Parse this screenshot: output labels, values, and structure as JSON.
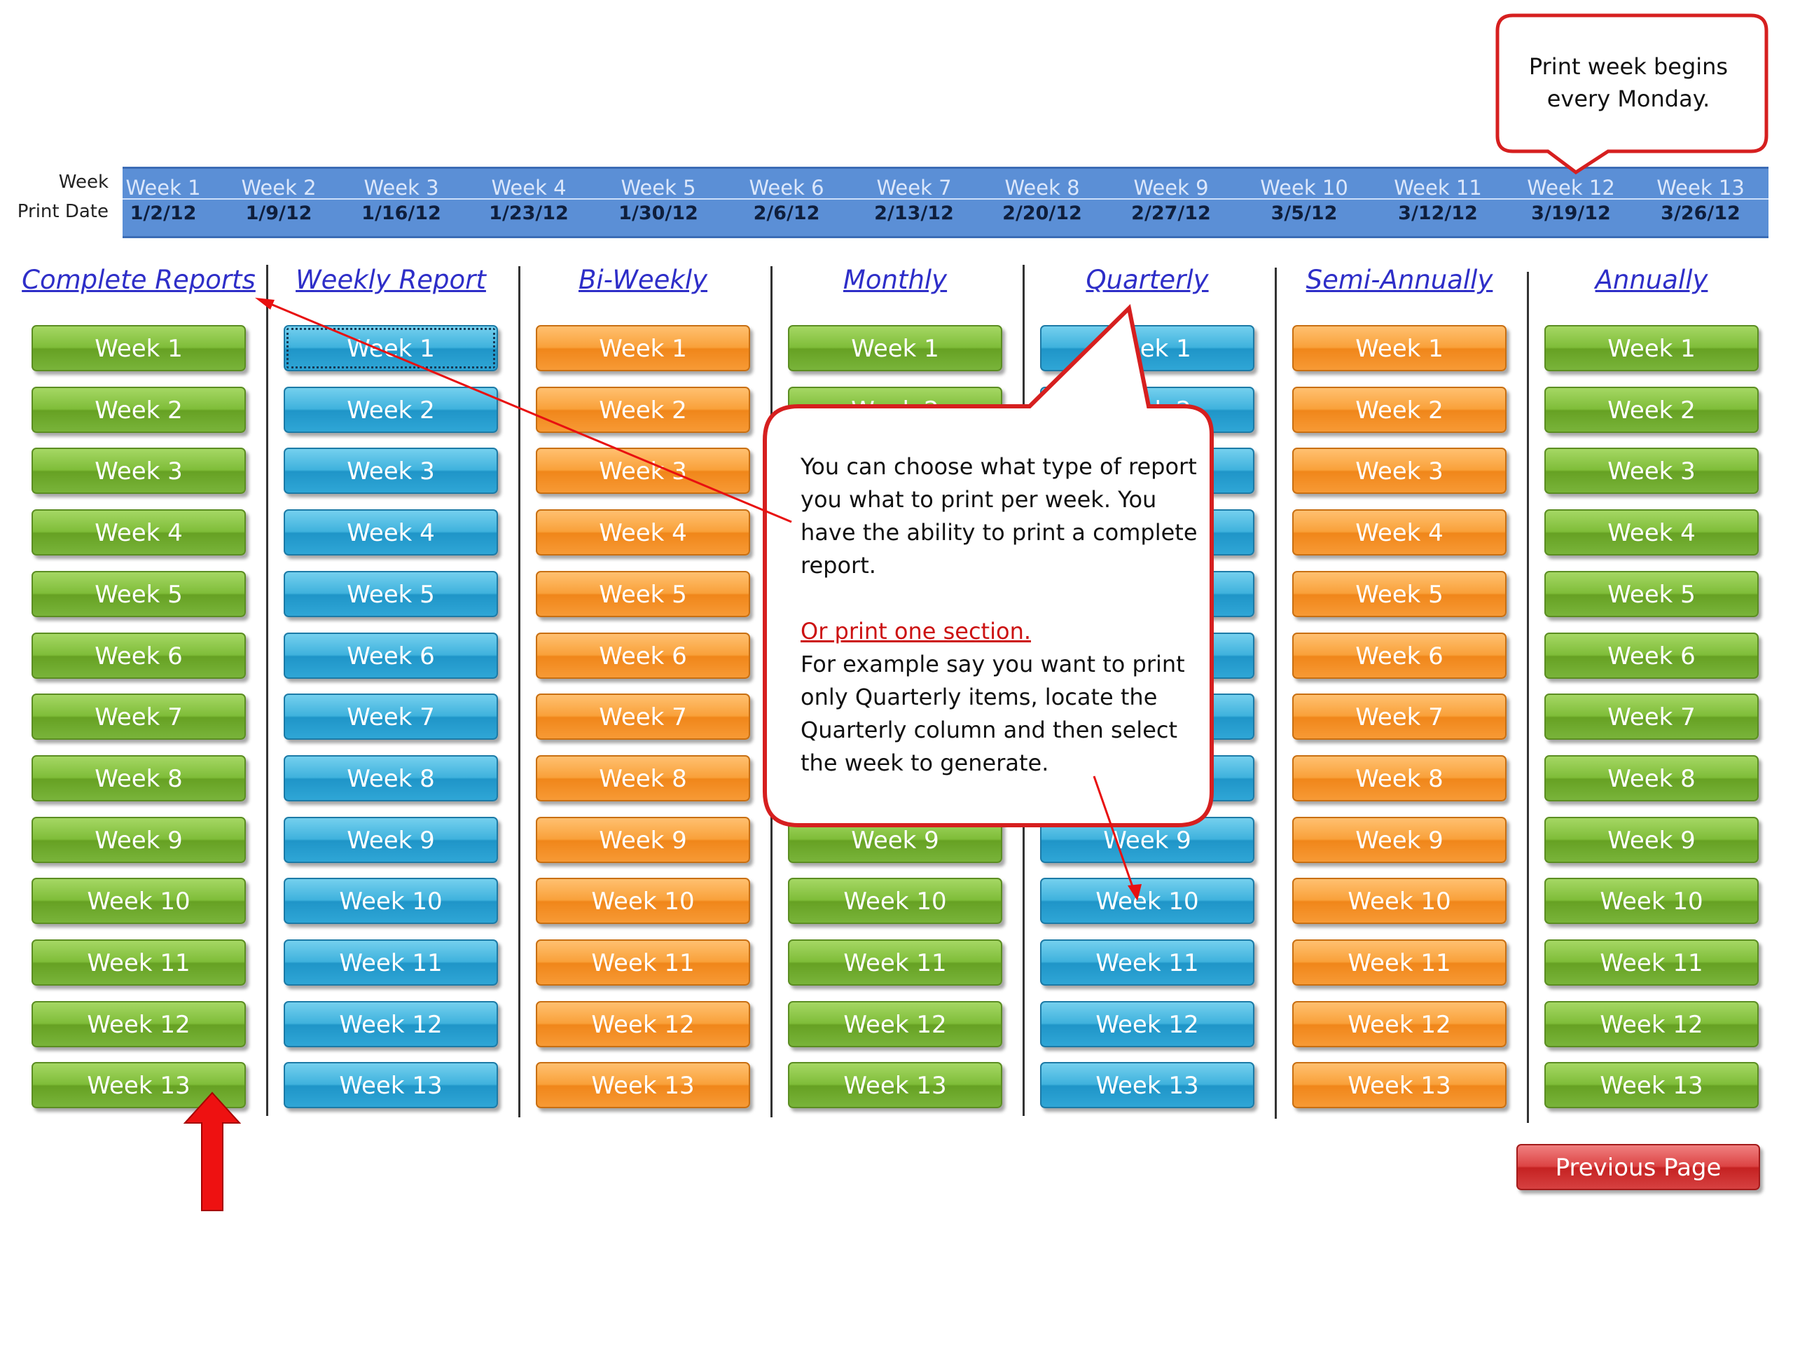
{
  "header": {
    "week_label": "Week",
    "print_date_label": "Print Date",
    "weeks": [
      {
        "week": "Week 1",
        "date": "1/2/12"
      },
      {
        "week": "Week 2",
        "date": "1/9/12"
      },
      {
        "week": "Week 3",
        "date": "1/16/12"
      },
      {
        "week": "Week 4",
        "date": "1/23/12"
      },
      {
        "week": "Week 5",
        "date": "1/30/12"
      },
      {
        "week": "Week 6",
        "date": "2/6/12"
      },
      {
        "week": "Week 7",
        "date": "2/13/12"
      },
      {
        "week": "Week 8",
        "date": "2/20/12"
      },
      {
        "week": "Week 9",
        "date": "2/27/12"
      },
      {
        "week": "Week 10",
        "date": "3/5/12"
      },
      {
        "week": "Week 11",
        "date": "3/12/12"
      },
      {
        "week": "Week 12",
        "date": "3/19/12"
      },
      {
        "week": "Week 13",
        "date": "3/26/12"
      }
    ]
  },
  "columns": [
    {
      "title": "Complete Reports",
      "color": "green"
    },
    {
      "title": "Weekly Report",
      "color": "blue"
    },
    {
      "title": "Bi-Weekly",
      "color": "orange"
    },
    {
      "title": "Monthly",
      "color": "green"
    },
    {
      "title": "Quarterly",
      "color": "blue"
    },
    {
      "title": "Semi-Annually",
      "color": "orange"
    },
    {
      "title": "Annually",
      "color": "green"
    }
  ],
  "week_buttons": [
    "Week 1",
    "Week 2",
    "Week 3",
    "Week 4",
    "Week 5",
    "Week 6",
    "Week 7",
    "Week 8",
    "Week 9",
    "Week 10",
    "Week 11",
    "Week 12",
    "Week 13"
  ],
  "selected_button": {
    "column": 1,
    "week": 0
  },
  "previous_page_label": "Previous Page",
  "callouts": {
    "top": "Print week begins every Monday.",
    "main": {
      "intro": "You can choose what type of report you what to print per week.  You have the ability to print a complete report.",
      "red_line": "Or print one section.",
      "example": "For example say you want to print only Quarterly items, locate the Quarterly column and then select the week to generate."
    }
  },
  "colors": {
    "header_strip": "#5b8fd6",
    "callout_border": "#d61f1f",
    "arrow": "#e81010",
    "link": "#2e2ec8",
    "green_button": "#7fbd39",
    "blue_button": "#3fb2dd",
    "orange_button": "#f9a13a",
    "previous_button": "#dc4444"
  }
}
